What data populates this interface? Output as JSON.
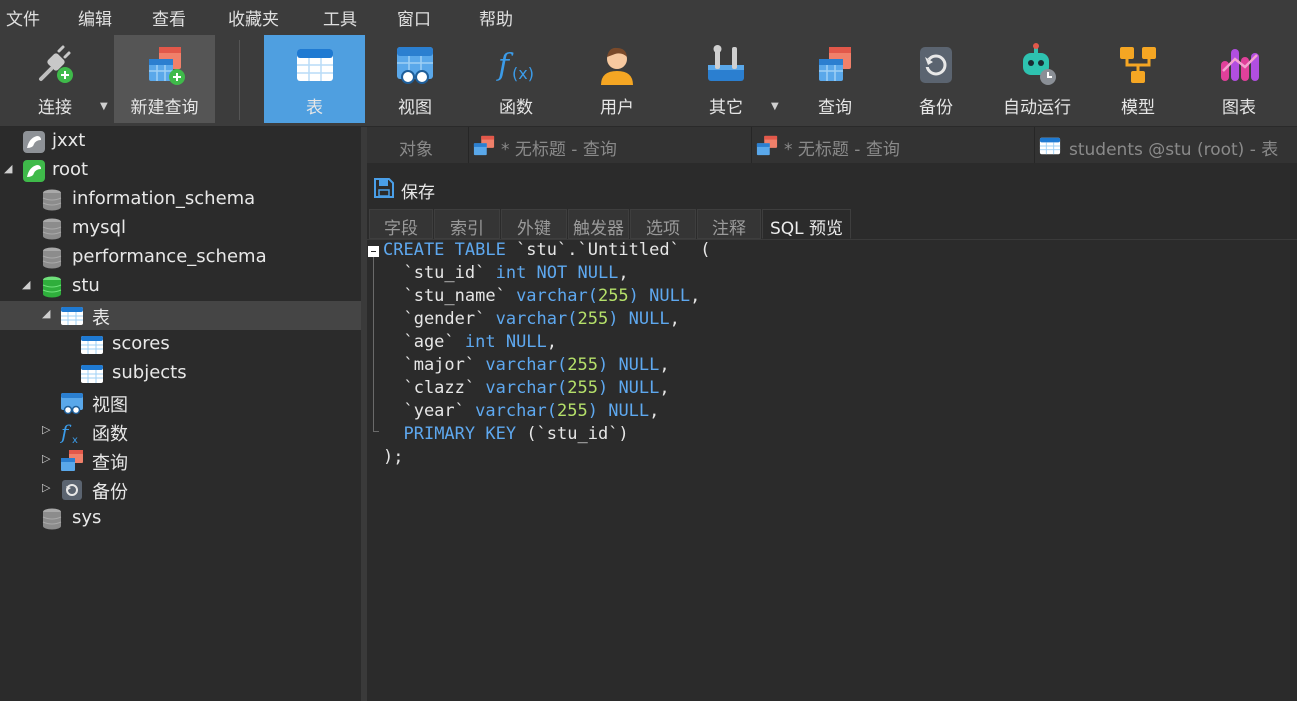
{
  "menu": [
    "文件",
    "编辑",
    "查看",
    "收藏夹",
    "工具",
    "窗口",
    "帮助"
  ],
  "toolbar": [
    {
      "label": "连接",
      "icon": "plug-connect-icon"
    },
    {
      "label": "新建查询",
      "icon": "new-query-icon"
    },
    {
      "label": "表",
      "icon": "table-icon"
    },
    {
      "label": "视图",
      "icon": "view-icon"
    },
    {
      "label": "函数",
      "icon": "function-icon"
    },
    {
      "label": "用户",
      "icon": "user-icon"
    },
    {
      "label": "其它",
      "icon": "tools-icon"
    },
    {
      "label": "查询",
      "icon": "query-icon"
    },
    {
      "label": "备份",
      "icon": "backup-icon"
    },
    {
      "label": "自动运行",
      "icon": "robot-icon"
    },
    {
      "label": "模型",
      "icon": "model-icon"
    },
    {
      "label": "图表",
      "icon": "chart-icon"
    }
  ],
  "tree": [
    {
      "label": "jxxt"
    },
    {
      "label": "root"
    },
    {
      "label": "information_schema"
    },
    {
      "label": "mysql"
    },
    {
      "label": "performance_schema"
    },
    {
      "label": "stu"
    },
    {
      "label": "表"
    },
    {
      "label": "scores"
    },
    {
      "label": "subjects"
    },
    {
      "label": "视图"
    },
    {
      "label": "函数"
    },
    {
      "label": "查询"
    },
    {
      "label": "备份"
    },
    {
      "label": "sys"
    }
  ],
  "tabs": [
    {
      "label": "对象"
    },
    {
      "label": "* 无标题 - 查询"
    },
    {
      "label": "* 无标题 - 查询"
    },
    {
      "label": "students @stu (root) - 表"
    }
  ],
  "editor": {
    "save_label": "保存",
    "subtabs": [
      "字段",
      "索引",
      "外键",
      "触发器",
      "选项",
      "注释",
      "SQL 预览"
    ],
    "active_subtab": "SQL 预览"
  },
  "sql": {
    "l0": {
      "kw1": "CREATE TABLE",
      "rest": " `stu`.`Untitled`  ("
    },
    "l1": {
      "a": "  `stu_id` ",
      "kw": "int NOT NULL",
      "b": ","
    },
    "l2": {
      "a": "  `stu_name` ",
      "kw": "varchar(",
      "n": "255",
      "kw2": ") NULL",
      "b": ","
    },
    "l3": {
      "a": "  `gender` ",
      "kw": "varchar(",
      "n": "255",
      "kw2": ") NULL",
      "b": ","
    },
    "l4": {
      "a": "  `age` ",
      "kw": "int NULL",
      "b": ","
    },
    "l5": {
      "a": "  `major` ",
      "kw": "varchar(",
      "n": "255",
      "kw2": ") NULL",
      "b": ","
    },
    "l6": {
      "a": "  `clazz` ",
      "kw": "varchar(",
      "n": "255",
      "kw2": ") NULL",
      "b": ","
    },
    "l7": {
      "a": "  `year` ",
      "kw": "varchar(",
      "n": "255",
      "kw2": ") NULL",
      "b": ","
    },
    "l8": {
      "a": "  ",
      "kw": "PRIMARY KEY",
      "b": " (`stu_id`)"
    },
    "l9": {
      "a": ");"
    }
  }
}
